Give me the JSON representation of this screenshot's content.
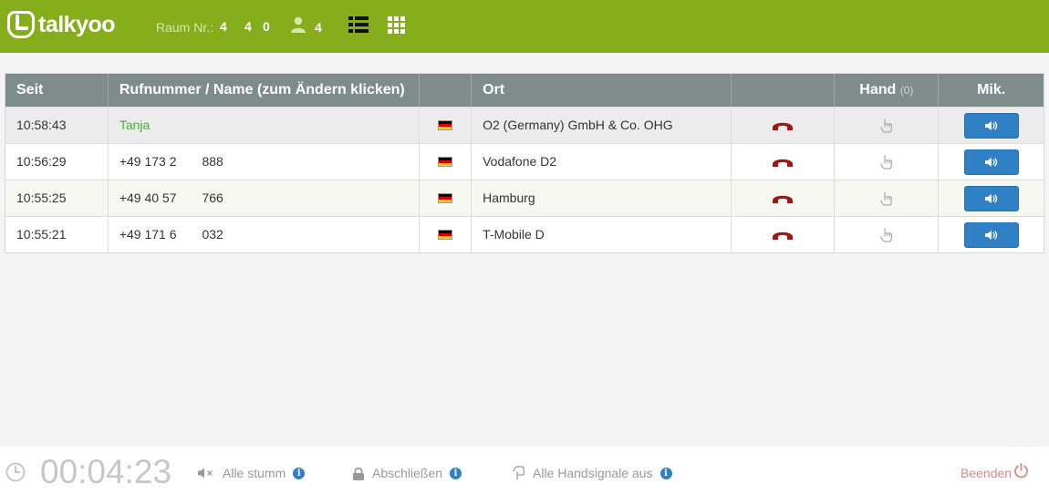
{
  "header": {
    "logo_text": "talkyoo",
    "room_label": "Raum Nr.:",
    "room_digits": [
      "4",
      "4",
      "0"
    ],
    "participants_count": "4",
    "icons": [
      "user-icon",
      "list-view-icon",
      "grid-view-icon"
    ]
  },
  "table": {
    "columns": {
      "seit": "Seit",
      "number": "Rufnummer / Name (zum Ändern klicken)",
      "flag": "",
      "ort": "Ort",
      "status": "",
      "hand": "Hand",
      "hand_count": "(0)",
      "mic": "Mik."
    },
    "rows": [
      {
        "time": "10:58:43",
        "number": "Tanja",
        "location": "O2 (Germany) GmbH & Co. OHG",
        "highlight": true
      },
      {
        "time": "10:56:29",
        "number": "+49 173 2  888",
        "location": "Vodafone D2",
        "highlight": false
      },
      {
        "time": "10:55:25",
        "number": "+49 40 57  766",
        "location": "Hamburg",
        "highlight": false
      },
      {
        "time": "10:55:21",
        "number": "+49 171 6  032",
        "location": "T-Mobile D",
        "highlight": false
      }
    ]
  },
  "footer": {
    "timer": "00:04:23",
    "mute_all": "Alle stumm",
    "lock": "Abschließen",
    "hands_off": "Alle Handsignale aus",
    "end": "Beenden"
  },
  "colors": {
    "header_bg": "#86ad1c",
    "table_header_bg": "#7e8d8a",
    "accent_blue": "#2f80c4",
    "hangup_red": "#a01616",
    "name_green": "#44b133"
  }
}
